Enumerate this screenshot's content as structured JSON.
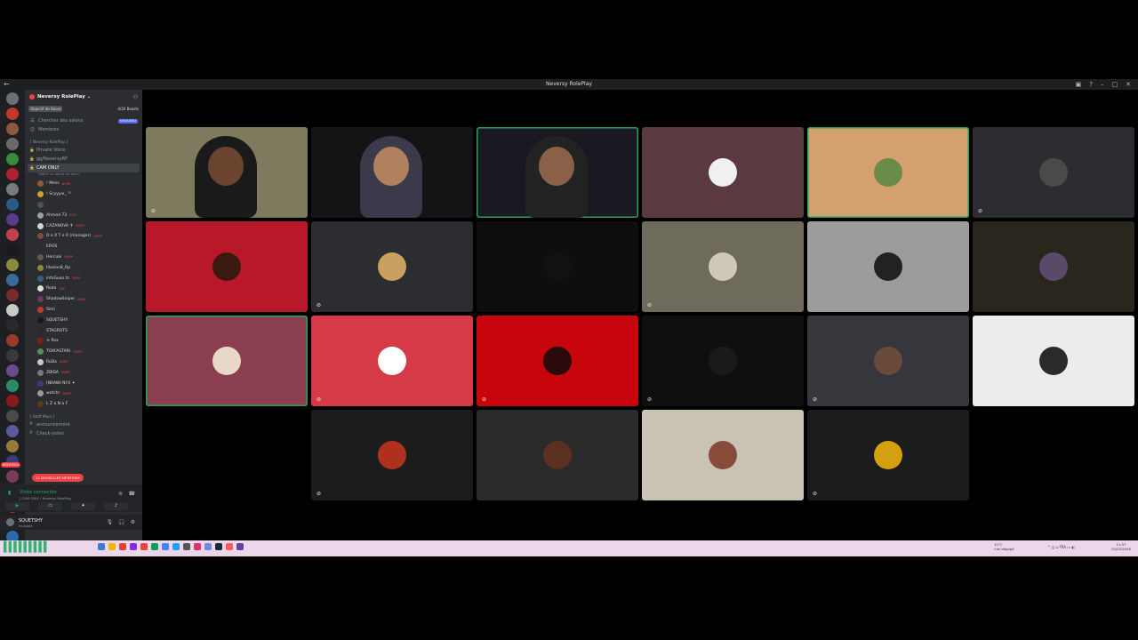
{
  "window": {
    "title": "Neversy RolePlay",
    "back_icon": "arrow-left-icon",
    "controls": [
      "inbox-icon",
      "help-icon",
      "minimize-icon",
      "maximize-icon",
      "close-icon"
    ]
  },
  "server": {
    "name": "Neversy RolePlay",
    "boost_goal": "Objectif de Boost",
    "boost_count": "4/20 Boosts"
  },
  "nav": [
    {
      "label": "Chercher des salons",
      "badge": "NOUVEAU"
    },
    {
      "label": "Membres",
      "badge": ""
    }
  ],
  "categories": {
    "main": "[ Neversy RolePlay ]",
    "staff": "[ Staff Main ]"
  },
  "channels": [
    {
      "label": "Private Voice",
      "active": false
    },
    {
      "label": "gg/NeversyRP",
      "active": false
    },
    {
      "label": "CAM ONLY",
      "active": true
    }
  ],
  "channel_sub": "Définir un statut de salon",
  "voice_users": [
    {
      "name": "! Mess",
      "tag": "NVRP",
      "color": "#8a5a3c"
    },
    {
      "name": "! Scyyyix_ ¹⁵",
      "tag": "",
      "color": "#c9a227"
    },
    {
      "name": "",
      "tag": "",
      "color": "#4e5058"
    },
    {
      "name": "Ahmed 73",
      "tag": "EGO",
      "color": "#9aa0a6"
    },
    {
      "name": "CAZANOVA ✝",
      "tag": "NVRP",
      "color": "#d4d4d4"
    },
    {
      "name": "D e X T e R (manager)",
      "tag": "NVRP",
      "color": "#7a4f3a"
    },
    {
      "name": "EROS",
      "tag": "",
      "color": "#2e2e2e"
    },
    {
      "name": "Hercule",
      "tag": "NVRP",
      "color": "#5a5a5a"
    },
    {
      "name": "Illusion8_Rp",
      "tag": "",
      "color": "#8a8a3a"
    },
    {
      "name": "infoGuan.tc",
      "tag": "NVRP",
      "color": "#3a5a8a"
    },
    {
      "name": "Roda",
      "tag": "OSC",
      "color": "#e0e0e0"
    },
    {
      "name": "ShadowSniper",
      "tag": "NVRP",
      "color": "#6a3a6a"
    },
    {
      "name": "Simi",
      "tag": "",
      "color": "#c0392b"
    },
    {
      "name": "SQUETSHY",
      "tag": "",
      "color": "#1a1a1a"
    },
    {
      "name": "STAGROTS",
      "tag": "",
      "color": "#2a2a2a"
    },
    {
      "name": "☠ Rex",
      "tag": "",
      "color": "#8a1a1a"
    },
    {
      "name": "TOXFASTARI",
      "tag": "OSRP",
      "color": "#5a8a5a"
    },
    {
      "name": "RoDa",
      "tag": "NVRP",
      "color": "#c8c8c8"
    },
    {
      "name": "ZBIDA",
      "tag": "NVRP",
      "color": "#7a7a7a"
    },
    {
      "name": "[NRAWI NYX ✦",
      "tag": "",
      "color": "#3a3a7a"
    },
    {
      "name": "watchr",
      "tag": "NVRP",
      "color": "#9a9a9a"
    },
    {
      "name": "L Z a N a F",
      "tag": "",
      "color": "#5a3a1a"
    }
  ],
  "staff_channels": [
    {
      "label": "announcement"
    },
    {
      "label": "Check-votes"
    }
  ],
  "mentions_pill": "11 NOUVELLES MENTIONS",
  "rail_new_badge": "NOUVEAU",
  "voice_panel": {
    "status": "Vidéo connectée",
    "location": "| CAM ONLY / Neversy RolePlay",
    "buttons": [
      "camera-icon",
      "screen-share-icon",
      "activities-icon",
      "soundboard-icon"
    ]
  },
  "user_panel": {
    "name": "SQUETSHY",
    "status": "Invisible"
  },
  "tiles": [
    {
      "kind": "camera",
      "bg": "#7d7a5e",
      "muted": true,
      "speaking": false,
      "name": "tile-camera-1"
    },
    {
      "kind": "camera",
      "bg": "#141416",
      "muted": false,
      "speaking": false,
      "name": "tile-camera-2"
    },
    {
      "kind": "camera",
      "bg": "#1a1820",
      "muted": false,
      "speaking": true,
      "name": "tile-camera-3"
    },
    {
      "kind": "avatar",
      "bg": "#5a3a40",
      "avatar": "#f0f0f0",
      "muted": false,
      "speaking": false
    },
    {
      "kind": "avatar",
      "bg": "#d4a070",
      "avatar": "#6a8a4a",
      "muted": false,
      "speaking": true
    },
    {
      "kind": "avatar",
      "bg": "#2b2d31",
      "avatar": "#4a4a4a",
      "muted": true,
      "speaking": false
    },
    {
      "kind": "avatar",
      "bg": "#b9182a",
      "avatar": "#3a1a10",
      "muted": false,
      "speaking": false
    },
    {
      "kind": "avatar",
      "bg": "#2b2d31",
      "avatar": "#c8a060",
      "muted": true,
      "speaking": false
    },
    {
      "kind": "avatar",
      "bg": "#0e0e0e",
      "avatar": "#111111",
      "muted": false,
      "speaking": false
    },
    {
      "kind": "avatar",
      "bg": "#6e6a5c",
      "avatar": "#d0c8b8",
      "muted": true,
      "speaking": false
    },
    {
      "kind": "avatar",
      "bg": "#9c9c9c",
      "avatar": "#222222",
      "muted": false,
      "speaking": false
    },
    {
      "kind": "avatar",
      "bg": "#29261e",
      "avatar": "#5a4a6a",
      "muted": false,
      "speaking": false
    },
    {
      "kind": "avatar",
      "bg": "#8b3e50",
      "avatar": "#e8d8c8",
      "muted": false,
      "speaking": true
    },
    {
      "kind": "avatar",
      "bg": "#d63a47",
      "avatar": "#ffffff",
      "muted": true,
      "speaking": false
    },
    {
      "kind": "avatar",
      "bg": "#c8040c",
      "avatar": "#2a0a0a",
      "muted": true,
      "speaking": false
    },
    {
      "kind": "avatar",
      "bg": "#0f0f10",
      "avatar": "#1a1a1a",
      "muted": true,
      "speaking": false
    },
    {
      "kind": "avatar",
      "bg": "#36373c",
      "avatar": "#6a4a3a",
      "muted": true,
      "speaking": false
    },
    {
      "kind": "avatar",
      "bg": "#ececec",
      "avatar": "#2a2a2a",
      "muted": false,
      "speaking": false
    },
    {
      "kind": "empty"
    },
    {
      "kind": "avatar",
      "bg": "#1c1c1d",
      "avatar": "#b03020",
      "muted": true,
      "speaking": false
    },
    {
      "kind": "avatar",
      "bg": "#2a2a2b",
      "avatar": "#5a3020",
      "muted": false,
      "speaking": false
    },
    {
      "kind": "avatar",
      "bg": "#c8c3b4",
      "avatar": "#8a4a3a",
      "muted": false,
      "speaking": false
    },
    {
      "kind": "avatar",
      "bg": "#1c1c1d",
      "avatar": "#d4a010",
      "muted": true,
      "speaking": false
    },
    {
      "kind": "empty"
    }
  ],
  "taskbar": {
    "weather_temp": "10°C",
    "weather_text": "Ciel dégagé",
    "lang": "FRA",
    "time": "11:57",
    "date": "25/03/2026"
  }
}
